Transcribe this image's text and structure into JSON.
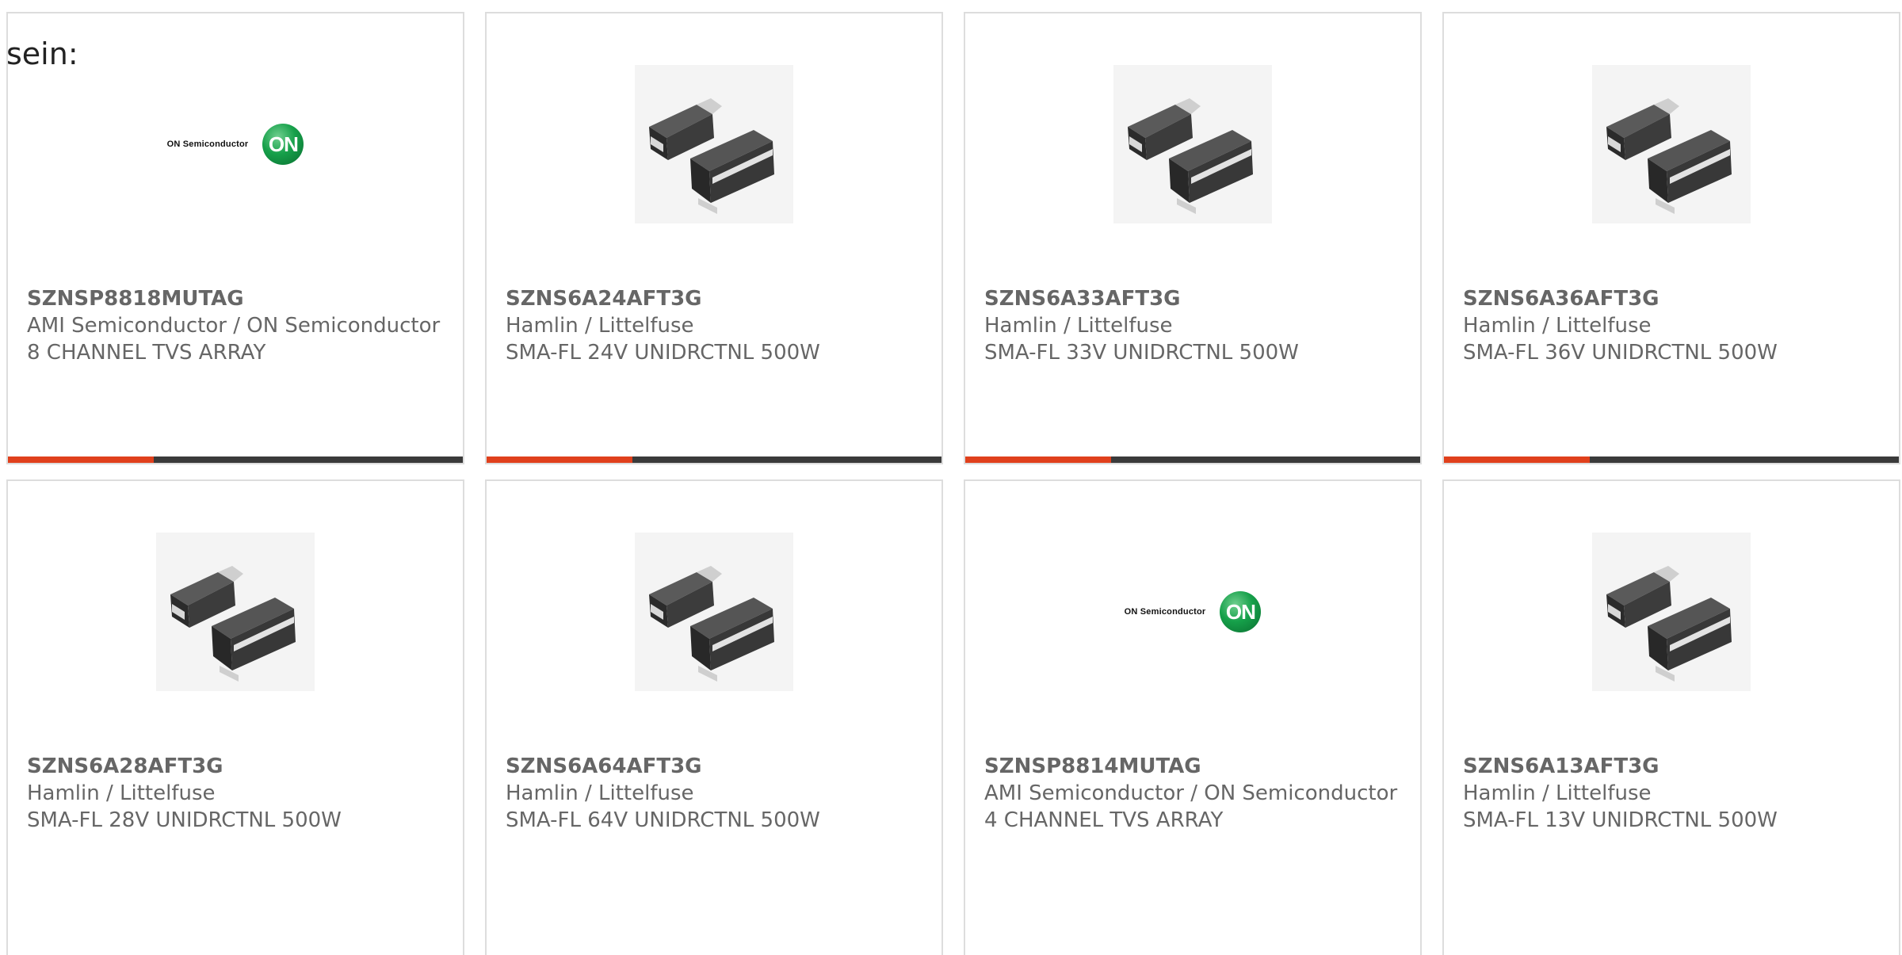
{
  "page_fragment": "sein:",
  "colors": {
    "accent": "#e0401c",
    "track": "#3a3a3a",
    "text": "#666666",
    "border": "#dddddd"
  },
  "cards": [
    {
      "part_number": "SZNSP8818MUTAG",
      "manufacturer": "AMI Semiconductor / ON Semiconductor",
      "description": "8 CHANNEL TVS ARRAY",
      "image": "on-semiconductor-logo",
      "logo_text": "ON Semiconductor",
      "logo_badge": "ON",
      "progress": 0.32
    },
    {
      "part_number": "SZNS6A24AFT3G",
      "manufacturer": "Hamlin / Littelfuse",
      "description": "SMA-FL 24V UNIDRCTNL 500W",
      "image": "sma-fl-package-photo",
      "progress": 0.32
    },
    {
      "part_number": "SZNS6A33AFT3G",
      "manufacturer": "Hamlin / Littelfuse",
      "description": "SMA-FL 33V UNIDRCTNL 500W",
      "image": "sma-fl-package-photo",
      "progress": 0.32
    },
    {
      "part_number": "SZNS6A36AFT3G",
      "manufacturer": "Hamlin / Littelfuse",
      "description": "SMA-FL 36V UNIDRCTNL 500W",
      "image": "sma-fl-package-photo",
      "progress": 0.32
    },
    {
      "part_number": "SZNS6A28AFT3G",
      "manufacturer": "Hamlin / Littelfuse",
      "description": "SMA-FL 28V UNIDRCTNL 500W",
      "image": "sma-fl-package-photo"
    },
    {
      "part_number": "SZNS6A64AFT3G",
      "manufacturer": "Hamlin / Littelfuse",
      "description": "SMA-FL 64V UNIDRCTNL 500W",
      "image": "sma-fl-package-photo"
    },
    {
      "part_number": "SZNSP8814MUTAG",
      "manufacturer": "AMI Semiconductor / ON Semiconductor",
      "description": "4 CHANNEL TVS ARRAY",
      "image": "on-semiconductor-logo",
      "logo_text": "ON Semiconductor",
      "logo_badge": "ON"
    },
    {
      "part_number": "SZNS6A13AFT3G",
      "manufacturer": "Hamlin / Littelfuse",
      "description": "SMA-FL 13V UNIDRCTNL 500W",
      "image": "sma-fl-package-photo"
    }
  ]
}
